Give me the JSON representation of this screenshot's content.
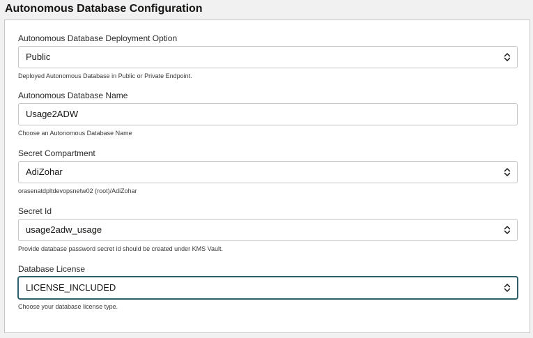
{
  "page": {
    "title": "Autonomous Database Configuration"
  },
  "fields": [
    {
      "label": "Autonomous Database Deployment Option",
      "value": "Public",
      "help": "Deployed Autonomous Database in Public or Private Endpoint.",
      "type": "select",
      "icon": "chevron-up-down-icon"
    },
    {
      "label": "Autonomous Database Name",
      "value": "Usage2ADW",
      "help": "Choose an Autonomous Database Name",
      "type": "text"
    },
    {
      "label": "Secret Compartment",
      "value": "AdiZohar",
      "help": "orasenatdpltdevopsnetw02 (root)/AdiZohar",
      "type": "select",
      "icon": "chevron-up-down-icon"
    },
    {
      "label": "Secret Id",
      "value": "usage2adw_usage",
      "help": "Provide database password secret id should be created under KMS Vault.",
      "type": "select",
      "icon": "chevron-up-down-icon"
    },
    {
      "label": "Database License",
      "value": "LICENSE_INCLUDED",
      "help": "Choose your database license type.",
      "type": "select",
      "focused": true,
      "icon": "chevron-up-down-icon"
    }
  ],
  "colors": {
    "background": "#f1f1f1",
    "panel": "#ffffff",
    "border": "#c4c4c4",
    "focus_border": "#2c5f6b",
    "text": "#161513"
  }
}
